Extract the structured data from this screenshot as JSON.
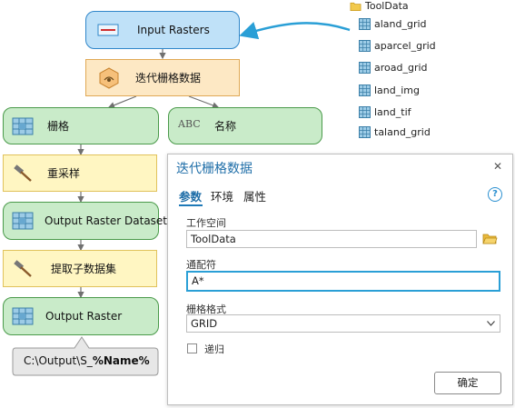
{
  "model": {
    "input_rasters": "Input Rasters",
    "iterate": "迭代栅格数据",
    "raster": "栅格",
    "name_var": "名称",
    "abc": "ABC",
    "resample": "重采样",
    "output_raster_dataset": "Output Raster Dataset",
    "extract_subdataset": "提取子数据集",
    "output_raster": "Output Raster",
    "callout_prefix": "C:\\Output\\S_",
    "callout_var": "%Name%"
  },
  "tree": {
    "folder": "ToolData",
    "items": [
      "aland_grid",
      "aparcel_grid",
      "aroad_grid",
      "land_img",
      "land_tif",
      "taland_grid"
    ]
  },
  "dialog": {
    "title": "迭代栅格数据",
    "close": "✕",
    "tabs": [
      "参数",
      "环境",
      "属性"
    ],
    "help": "?",
    "workspace_label": "工作空间",
    "workspace_value": "ToolData",
    "wildcard_label": "通配符",
    "wildcard_value": "A*",
    "format_label": "栅格格式",
    "format_value": "GRID",
    "recursive_label": "递归",
    "ok_button": "确定"
  },
  "colors": {
    "accent": "#1f7ab8",
    "data_fill": "#c9ebc9",
    "data_border": "#4a9a4a",
    "tool_fill": "#fff6c2",
    "iter_fill": "#fde8c4",
    "input_fill": "#bfe1f8",
    "arrow_blue": "#2a9fd6"
  }
}
